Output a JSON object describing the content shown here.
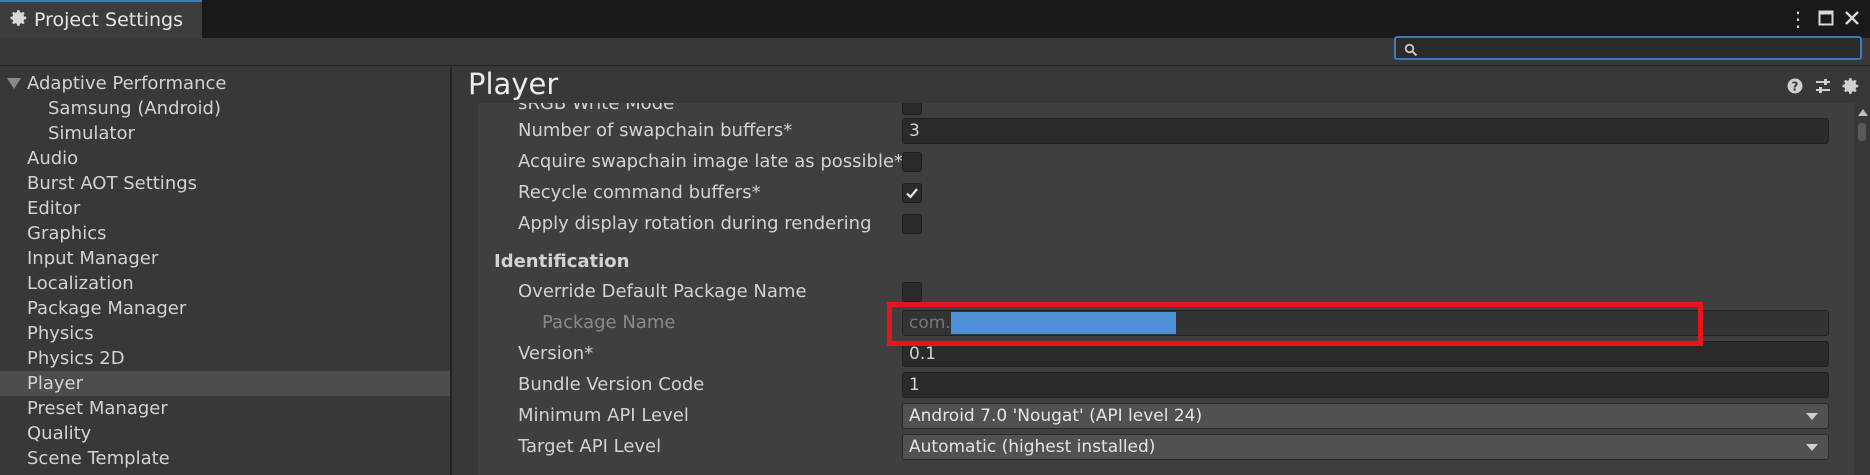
{
  "window": {
    "tab_title": "Project Settings"
  },
  "search": {
    "value": "",
    "placeholder": ""
  },
  "sidebar": {
    "items": [
      {
        "label": "Adaptive Performance",
        "indent": 0,
        "expanded": true,
        "selected": false
      },
      {
        "label": "Samsung (Android)",
        "indent": 1,
        "selected": false
      },
      {
        "label": "Simulator",
        "indent": 1,
        "selected": false
      },
      {
        "label": "Audio",
        "indent": 0,
        "selected": false
      },
      {
        "label": "Burst AOT Settings",
        "indent": 0,
        "selected": false
      },
      {
        "label": "Editor",
        "indent": 0,
        "selected": false
      },
      {
        "label": "Graphics",
        "indent": 0,
        "selected": false
      },
      {
        "label": "Input Manager",
        "indent": 0,
        "selected": false
      },
      {
        "label": "Localization",
        "indent": 0,
        "selected": false
      },
      {
        "label": "Package Manager",
        "indent": 0,
        "selected": false
      },
      {
        "label": "Physics",
        "indent": 0,
        "selected": false
      },
      {
        "label": "Physics 2D",
        "indent": 0,
        "selected": false
      },
      {
        "label": "Player",
        "indent": 0,
        "selected": true
      },
      {
        "label": "Preset Manager",
        "indent": 0,
        "selected": false
      },
      {
        "label": "Quality",
        "indent": 0,
        "selected": false
      },
      {
        "label": "Scene Template",
        "indent": 0,
        "selected": false
      }
    ]
  },
  "main": {
    "title": "Player",
    "partial_label": "sRGB Write Mode",
    "rows": {
      "swapchain": {
        "label": "Number of swapchain buffers*",
        "value": "3"
      },
      "acquire_late": {
        "label": "Acquire swapchain image late as possible*",
        "checked": false
      },
      "recycle": {
        "label": "Recycle command buffers*",
        "checked": true
      },
      "display_rotation": {
        "label": "Apply display rotation during rendering",
        "checked": false
      },
      "identification": {
        "label": "Identification"
      },
      "override_pkg": {
        "label": "Override Default Package Name",
        "checked": false
      },
      "package_name": {
        "label": "Package Name",
        "value": "com."
      },
      "version": {
        "label": "Version*",
        "value": "0.1"
      },
      "bundle_code": {
        "label": "Bundle Version Code",
        "value": "1"
      },
      "min_api": {
        "label": "Minimum API Level",
        "value": "Android 7.0 'Nougat' (API level 24)"
      },
      "target_api": {
        "label": "Target API Level",
        "value": "Automatic (highest installed)"
      }
    }
  },
  "colors": {
    "accent": "#3a79bb",
    "selection": "#4d90d6",
    "highlight_box": "#e8141c"
  }
}
